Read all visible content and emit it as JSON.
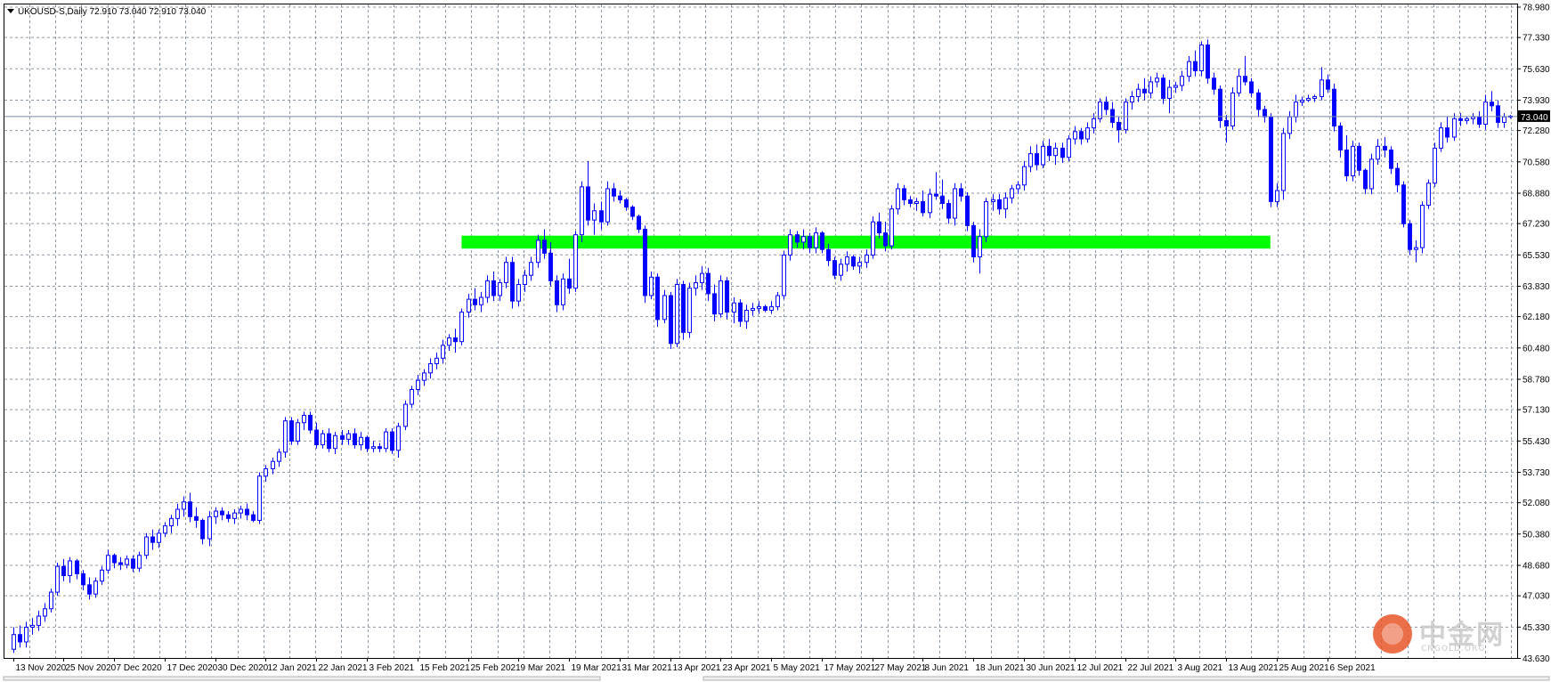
{
  "window": {
    "header": "UKOUSD-S,Daily  72.910 73.040 72.910 73.040",
    "header_icon": "dropdown-triangle-icon"
  },
  "watermark": {
    "text_cn": "中金网",
    "text_en": "CNGOLD.ORG",
    "icon": "cngold-logo-icon"
  },
  "colors": {
    "background": "#ffffff",
    "grid": "#8c97a5",
    "candle": "#0000ff",
    "zone": "#00ff00",
    "axis": "#000000",
    "current_bg": "#000000",
    "current_line": "#7a8aa0"
  },
  "chart_data": {
    "type": "candlestick",
    "symbol": "UKOUSD-S",
    "timeframe": "Daily",
    "ohlc_header": {
      "open": 72.91,
      "high": 73.04,
      "low": 72.91,
      "close": 73.04
    },
    "current_price": 73.04,
    "current_price_label": "73.040",
    "ylim": [
      43.63,
      79.1
    ],
    "y_ticks": [
      78.98,
      77.33,
      75.63,
      73.93,
      72.28,
      70.58,
      68.88,
      67.23,
      65.53,
      63.83,
      62.18,
      60.48,
      58.78,
      57.13,
      55.43,
      53.73,
      52.08,
      50.38,
      48.68,
      47.03,
      45.33,
      43.63
    ],
    "y_tick_labels": [
      "78.980",
      "77.330",
      "75.630",
      "73.930",
      "72.280",
      "70.580",
      "68.880",
      "67.230",
      "65.530",
      "63.830",
      "62.180",
      "60.480",
      "58.780",
      "57.130",
      "55.430",
      "53.730",
      "52.080",
      "50.380",
      "48.680",
      "47.030",
      "45.330",
      "43.630"
    ],
    "x_labels": [
      "13 Nov 2020",
      "25 Nov 2020",
      "7 Dec 2020",
      "17 Dec 2020",
      "30 Dec 2020",
      "12 Jan 2021",
      "22 Jan 2021",
      "3 Feb 2021",
      "15 Feb 2021",
      "25 Feb 2021",
      "9 Mar 2021",
      "19 Mar 2021",
      "31 Mar 2021",
      "13 Apr 2021",
      "23 Apr 2021",
      "5 May 2021",
      "17 May 2021",
      "27 May 2021",
      "8 Jun 2021",
      "18 Jun 2021",
      "30 Jun 2021",
      "12 Jul 2021",
      "22 Jul 2021",
      "3 Aug 2021",
      "13 Aug 2021",
      "25 Aug 2021",
      "6 Sep 2021"
    ],
    "x_label_bar_index": [
      0,
      8,
      16,
      24,
      32,
      40,
      48,
      56,
      64,
      72,
      80,
      88,
      96,
      104,
      112,
      120,
      128,
      136,
      144,
      152,
      160,
      168,
      176,
      184,
      192,
      200,
      208
    ],
    "support_zone": {
      "from": 65.85,
      "to": 66.55,
      "start_bar": 71,
      "end_bar": 199
    },
    "grid": true,
    "candles": [
      [
        44.1,
        45.3,
        43.9,
        44.9
      ],
      [
        44.9,
        45.4,
        44.2,
        44.5
      ],
      [
        44.5,
        45.6,
        44.2,
        45.3
      ],
      [
        45.3,
        45.8,
        44.9,
        45.4
      ],
      [
        45.4,
        46.2,
        45.1,
        45.9
      ],
      [
        45.9,
        46.6,
        45.6,
        46.3
      ],
      [
        46.3,
        47.4,
        46.1,
        47.2
      ],
      [
        47.2,
        48.8,
        47.0,
        48.6
      ],
      [
        48.6,
        49.0,
        47.8,
        48.1
      ],
      [
        48.1,
        49.1,
        47.7,
        48.9
      ],
      [
        48.9,
        49.0,
        47.9,
        48.2
      ],
      [
        48.2,
        48.4,
        47.3,
        47.6
      ],
      [
        47.6,
        48.0,
        46.8,
        47.1
      ],
      [
        47.1,
        48.0,
        46.9,
        47.8
      ],
      [
        47.8,
        48.6,
        47.6,
        48.4
      ],
      [
        48.4,
        49.5,
        48.2,
        49.2
      ],
      [
        49.2,
        49.3,
        48.5,
        48.8
      ],
      [
        48.8,
        49.1,
        48.4,
        48.7
      ],
      [
        48.7,
        49.2,
        48.5,
        49.0
      ],
      [
        49.0,
        49.2,
        48.3,
        48.5
      ],
      [
        48.5,
        49.4,
        48.3,
        49.2
      ],
      [
        49.2,
        50.4,
        49.0,
        50.2
      ],
      [
        50.2,
        50.6,
        49.5,
        49.9
      ],
      [
        49.9,
        50.6,
        49.6,
        50.4
      ],
      [
        50.4,
        51.0,
        50.2,
        50.8
      ],
      [
        50.8,
        51.4,
        50.4,
        51.2
      ],
      [
        51.2,
        52.0,
        50.8,
        51.7
      ],
      [
        51.7,
        52.4,
        51.3,
        52.1
      ],
      [
        52.1,
        52.6,
        51.0,
        51.3
      ],
      [
        51.3,
        51.8,
        50.7,
        51.1
      ],
      [
        51.1,
        51.2,
        49.8,
        50.1
      ],
      [
        50.1,
        51.6,
        49.7,
        51.3
      ],
      [
        51.3,
        51.8,
        50.9,
        51.6
      ],
      [
        51.6,
        51.8,
        51.1,
        51.4
      ],
      [
        51.4,
        51.6,
        51.0,
        51.2
      ],
      [
        51.2,
        51.7,
        50.9,
        51.5
      ],
      [
        51.5,
        51.9,
        51.2,
        51.7
      ],
      [
        51.7,
        52.0,
        51.1,
        51.4
      ],
      [
        51.4,
        51.6,
        51.0,
        51.1
      ],
      [
        51.1,
        53.7,
        50.9,
        53.5
      ],
      [
        53.5,
        54.1,
        53.2,
        53.9
      ],
      [
        53.9,
        54.5,
        53.6,
        54.3
      ],
      [
        54.3,
        55.0,
        54.0,
        54.8
      ],
      [
        54.8,
        56.7,
        54.5,
        56.5
      ],
      [
        56.5,
        56.7,
        55.2,
        55.4
      ],
      [
        55.4,
        56.6,
        55.2,
        56.4
      ],
      [
        56.4,
        57.0,
        56.0,
        56.8
      ],
      [
        56.8,
        57.0,
        55.8,
        56.0
      ],
      [
        56.0,
        56.4,
        55.0,
        55.2
      ],
      [
        55.2,
        56.0,
        55.0,
        55.8
      ],
      [
        55.8,
        56.1,
        54.8,
        55.0
      ],
      [
        55.0,
        55.9,
        54.7,
        55.7
      ],
      [
        55.7,
        56.0,
        55.2,
        55.5
      ],
      [
        55.5,
        56.0,
        55.2,
        55.8
      ],
      [
        55.8,
        56.1,
        55.0,
        55.2
      ],
      [
        55.2,
        55.9,
        54.9,
        55.6
      ],
      [
        55.6,
        55.7,
        54.8,
        55.0
      ],
      [
        55.0,
        55.4,
        54.8,
        55.1
      ],
      [
        55.1,
        55.3,
        54.8,
        55.0
      ],
      [
        55.0,
        56.1,
        54.8,
        55.9
      ],
      [
        55.9,
        56.1,
        54.7,
        54.9
      ],
      [
        54.9,
        56.4,
        54.5,
        56.2
      ],
      [
        56.2,
        57.6,
        56.0,
        57.4
      ],
      [
        57.4,
        58.4,
        57.2,
        58.2
      ],
      [
        58.2,
        59.0,
        57.9,
        58.7
      ],
      [
        58.7,
        59.3,
        58.4,
        59.1
      ],
      [
        59.1,
        59.9,
        58.8,
        59.6
      ],
      [
        59.6,
        60.2,
        59.3,
        59.9
      ],
      [
        59.9,
        60.9,
        59.6,
        60.6
      ],
      [
        60.6,
        61.2,
        60.3,
        61.0
      ],
      [
        61.0,
        61.5,
        60.2,
        60.8
      ],
      [
        60.8,
        62.6,
        60.6,
        62.4
      ],
      [
        62.4,
        63.4,
        62.1,
        63.1
      ],
      [
        63.1,
        63.7,
        62.5,
        62.8
      ],
      [
        62.8,
        63.5,
        62.4,
        63.2
      ],
      [
        63.2,
        64.4,
        62.9,
        64.1
      ],
      [
        64.1,
        64.6,
        63.0,
        63.3
      ],
      [
        63.3,
        64.2,
        63.0,
        64.0
      ],
      [
        64.0,
        65.4,
        63.7,
        65.1
      ],
      [
        65.1,
        65.4,
        62.6,
        63.0
      ],
      [
        63.0,
        64.2,
        62.7,
        63.9
      ],
      [
        63.9,
        64.7,
        63.5,
        64.4
      ],
      [
        64.4,
        65.4,
        64.1,
        65.1
      ],
      [
        65.1,
        66.6,
        64.8,
        66.3
      ],
      [
        66.3,
        66.9,
        65.3,
        65.6
      ],
      [
        65.6,
        66.2,
        63.8,
        64.1
      ],
      [
        64.1,
        64.4,
        62.4,
        62.8
      ],
      [
        62.8,
        64.5,
        62.5,
        64.2
      ],
      [
        64.2,
        65.3,
        63.4,
        63.7
      ],
      [
        63.7,
        66.8,
        63.5,
        66.6
      ],
      [
        66.6,
        69.5,
        66.2,
        69.2
      ],
      [
        69.2,
        70.6,
        67.1,
        67.4
      ],
      [
        67.4,
        68.3,
        66.6,
        67.9
      ],
      [
        67.9,
        68.4,
        66.9,
        67.3
      ],
      [
        67.3,
        69.5,
        67.1,
        69.1
      ],
      [
        69.1,
        69.4,
        68.4,
        68.7
      ],
      [
        68.7,
        69.0,
        68.3,
        68.5
      ],
      [
        68.5,
        68.6,
        67.9,
        68.1
      ],
      [
        68.1,
        68.2,
        67.4,
        67.6
      ],
      [
        67.6,
        67.7,
        66.7,
        66.9
      ],
      [
        66.9,
        67.1,
        62.9,
        63.3
      ],
      [
        63.3,
        64.6,
        63.1,
        64.3
      ],
      [
        64.3,
        64.5,
        61.6,
        62.0
      ],
      [
        62.0,
        63.6,
        61.8,
        63.3
      ],
      [
        63.3,
        63.5,
        60.4,
        60.7
      ],
      [
        60.7,
        64.2,
        60.5,
        63.9
      ],
      [
        63.9,
        64.1,
        60.9,
        61.3
      ],
      [
        61.3,
        64.0,
        61.0,
        63.7
      ],
      [
        63.7,
        64.4,
        63.3,
        64.0
      ],
      [
        64.0,
        64.9,
        63.6,
        64.5
      ],
      [
        64.5,
        64.8,
        63.0,
        63.4
      ],
      [
        63.4,
        63.9,
        61.9,
        62.3
      ],
      [
        62.3,
        64.4,
        62.1,
        64.1
      ],
      [
        64.1,
        64.3,
        62.0,
        62.4
      ],
      [
        62.4,
        63.2,
        61.8,
        62.9
      ],
      [
        62.9,
        63.1,
        61.6,
        61.9
      ],
      [
        61.9,
        62.8,
        61.5,
        62.5
      ],
      [
        62.5,
        62.9,
        62.2,
        62.6
      ],
      [
        62.6,
        63.0,
        62.3,
        62.7
      ],
      [
        62.7,
        62.8,
        62.4,
        62.5
      ],
      [
        62.5,
        63.0,
        62.3,
        62.7
      ],
      [
        62.7,
        63.5,
        62.5,
        63.3
      ],
      [
        63.3,
        65.7,
        63.1,
        65.5
      ],
      [
        65.5,
        66.9,
        65.2,
        66.6
      ],
      [
        66.6,
        66.8,
        65.9,
        66.2
      ],
      [
        66.2,
        66.9,
        65.8,
        66.5
      ],
      [
        66.5,
        66.7,
        65.6,
        65.9
      ],
      [
        65.9,
        67.0,
        65.6,
        66.7
      ],
      [
        66.7,
        66.8,
        65.6,
        65.8
      ],
      [
        65.8,
        66.1,
        64.9,
        65.2
      ],
      [
        65.2,
        65.4,
        64.2,
        64.4
      ],
      [
        64.4,
        65.3,
        64.1,
        65.0
      ],
      [
        65.0,
        65.7,
        64.6,
        65.4
      ],
      [
        65.4,
        65.5,
        64.7,
        64.9
      ],
      [
        64.9,
        65.4,
        64.5,
        65.1
      ],
      [
        65.1,
        65.8,
        64.8,
        65.5
      ],
      [
        65.5,
        67.6,
        65.3,
        67.3
      ],
      [
        67.3,
        67.8,
        66.4,
        66.7
      ],
      [
        66.7,
        67.3,
        65.7,
        66.0
      ],
      [
        66.0,
        68.2,
        65.8,
        68.0
      ],
      [
        68.0,
        69.4,
        67.7,
        69.1
      ],
      [
        69.1,
        69.3,
        68.2,
        68.5
      ],
      [
        68.5,
        68.7,
        68.1,
        68.3
      ],
      [
        68.3,
        68.6,
        67.9,
        68.4
      ],
      [
        68.4,
        69.0,
        67.6,
        67.8
      ],
      [
        67.8,
        69.1,
        67.5,
        68.8
      ],
      [
        68.8,
        70.0,
        68.5,
        68.7
      ],
      [
        68.7,
        69.6,
        68.0,
        68.3
      ],
      [
        68.3,
        68.5,
        67.2,
        67.5
      ],
      [
        67.5,
        69.4,
        67.1,
        69.1
      ],
      [
        69.1,
        69.4,
        68.4,
        68.7
      ],
      [
        68.7,
        68.9,
        66.8,
        67.1
      ],
      [
        67.1,
        67.3,
        65.1,
        65.4
      ],
      [
        65.4,
        66.9,
        64.5,
        66.5
      ],
      [
        66.5,
        68.6,
        66.2,
        68.4
      ],
      [
        68.4,
        68.8,
        67.9,
        68.5
      ],
      [
        68.5,
        68.8,
        67.7,
        68.0
      ],
      [
        68.0,
        68.9,
        67.5,
        68.6
      ],
      [
        68.6,
        69.3,
        68.3,
        69.1
      ],
      [
        69.1,
        69.5,
        68.8,
        69.3
      ],
      [
        69.3,
        70.6,
        69.0,
        70.3
      ],
      [
        70.3,
        71.4,
        70.0,
        71.0
      ],
      [
        71.0,
        71.5,
        70.1,
        70.4
      ],
      [
        70.4,
        71.7,
        70.2,
        71.4
      ],
      [
        71.4,
        71.8,
        70.6,
        70.9
      ],
      [
        70.9,
        71.6,
        70.4,
        71.3
      ],
      [
        71.3,
        71.6,
        70.5,
        70.8
      ],
      [
        70.8,
        72.0,
        70.6,
        71.8
      ],
      [
        71.8,
        72.5,
        71.5,
        72.2
      ],
      [
        72.2,
        72.4,
        71.5,
        71.8
      ],
      [
        71.8,
        72.7,
        71.6,
        72.4
      ],
      [
        72.4,
        73.2,
        72.1,
        72.9
      ],
      [
        72.9,
        74.0,
        72.7,
        73.8
      ],
      [
        73.8,
        74.1,
        73.1,
        73.4
      ],
      [
        73.4,
        73.8,
        72.4,
        72.7
      ],
      [
        72.7,
        73.0,
        71.6,
        72.3
      ],
      [
        72.3,
        74.0,
        72.1,
        73.8
      ],
      [
        73.8,
        74.4,
        73.4,
        74.1
      ],
      [
        74.1,
        74.8,
        73.8,
        74.5
      ],
      [
        74.5,
        75.1,
        73.9,
        74.3
      ],
      [
        74.3,
        75.2,
        74.0,
        74.9
      ],
      [
        74.9,
        75.4,
        74.6,
        75.1
      ],
      [
        75.1,
        75.3,
        73.7,
        74.0
      ],
      [
        74.0,
        75.0,
        73.2,
        74.6
      ],
      [
        74.6,
        74.9,
        74.3,
        74.7
      ],
      [
        74.7,
        75.5,
        74.4,
        75.2
      ],
      [
        75.2,
        76.3,
        74.9,
        76.0
      ],
      [
        76.0,
        76.6,
        75.2,
        75.5
      ],
      [
        75.5,
        77.1,
        75.2,
        76.9
      ],
      [
        76.9,
        77.2,
        74.8,
        75.1
      ],
      [
        75.1,
        75.4,
        74.2,
        74.5
      ],
      [
        74.5,
        74.7,
        72.4,
        72.8
      ],
      [
        72.8,
        73.1,
        71.6,
        72.5
      ],
      [
        72.5,
        74.6,
        72.3,
        74.3
      ],
      [
        74.3,
        75.6,
        74.1,
        75.2
      ],
      [
        75.2,
        76.3,
        74.7,
        74.9
      ],
      [
        74.9,
        75.1,
        74.1,
        74.3
      ],
      [
        74.3,
        74.5,
        73.0,
        73.4
      ],
      [
        73.4,
        73.6,
        72.7,
        73.0
      ],
      [
        73.0,
        73.2,
        68.1,
        68.4
      ],
      [
        68.4,
        69.4,
        68.1,
        69.0
      ],
      [
        69.0,
        72.4,
        68.5,
        72.1
      ],
      [
        72.1,
        73.3,
        71.8,
        73.0
      ],
      [
        73.0,
        74.2,
        72.7,
        73.8
      ],
      [
        73.8,
        74.1,
        73.6,
        73.9
      ],
      [
        73.9,
        74.2,
        73.8,
        74.0
      ],
      [
        74.0,
        74.2,
        73.8,
        74.1
      ],
      [
        74.1,
        75.7,
        73.9,
        75.0
      ],
      [
        75.0,
        75.3,
        74.3,
        74.5
      ],
      [
        74.5,
        74.8,
        72.2,
        72.5
      ],
      [
        72.5,
        72.7,
        70.8,
        71.2
      ],
      [
        71.2,
        72.0,
        69.5,
        69.8
      ],
      [
        69.8,
        71.7,
        69.5,
        71.4
      ],
      [
        71.4,
        71.6,
        69.8,
        70.1
      ],
      [
        70.1,
        70.2,
        68.8,
        69.1
      ],
      [
        69.1,
        71.0,
        68.8,
        70.7
      ],
      [
        70.7,
        71.8,
        70.4,
        71.4
      ],
      [
        71.4,
        71.9,
        70.8,
        71.2
      ],
      [
        71.2,
        71.4,
        69.9,
        70.2
      ],
      [
        70.2,
        70.5,
        68.9,
        69.3
      ],
      [
        69.3,
        69.5,
        67.0,
        67.2
      ],
      [
        67.2,
        67.4,
        65.5,
        65.8
      ],
      [
        65.8,
        66.3,
        65.1,
        65.9
      ],
      [
        65.9,
        68.4,
        65.6,
        68.2
      ],
      [
        68.2,
        69.6,
        68.0,
        69.4
      ],
      [
        69.4,
        71.6,
        69.2,
        71.3
      ],
      [
        71.3,
        72.7,
        71.1,
        72.4
      ],
      [
        72.4,
        73.0,
        71.6,
        71.9
      ],
      [
        71.9,
        73.2,
        71.7,
        72.9
      ],
      [
        72.9,
        73.2,
        72.5,
        72.8
      ],
      [
        72.8,
        73.0,
        72.6,
        72.9
      ],
      [
        72.9,
        73.2,
        72.6,
        73.0
      ],
      [
        73.0,
        73.3,
        72.4,
        72.6
      ],
      [
        72.6,
        74.2,
        72.3,
        73.8
      ],
      [
        73.8,
        74.4,
        73.3,
        73.6
      ],
      [
        73.6,
        73.9,
        72.4,
        72.7
      ],
      [
        72.7,
        73.2,
        72.4,
        73.0
      ],
      [
        73.0,
        73.1,
        72.9,
        73.04
      ]
    ]
  }
}
